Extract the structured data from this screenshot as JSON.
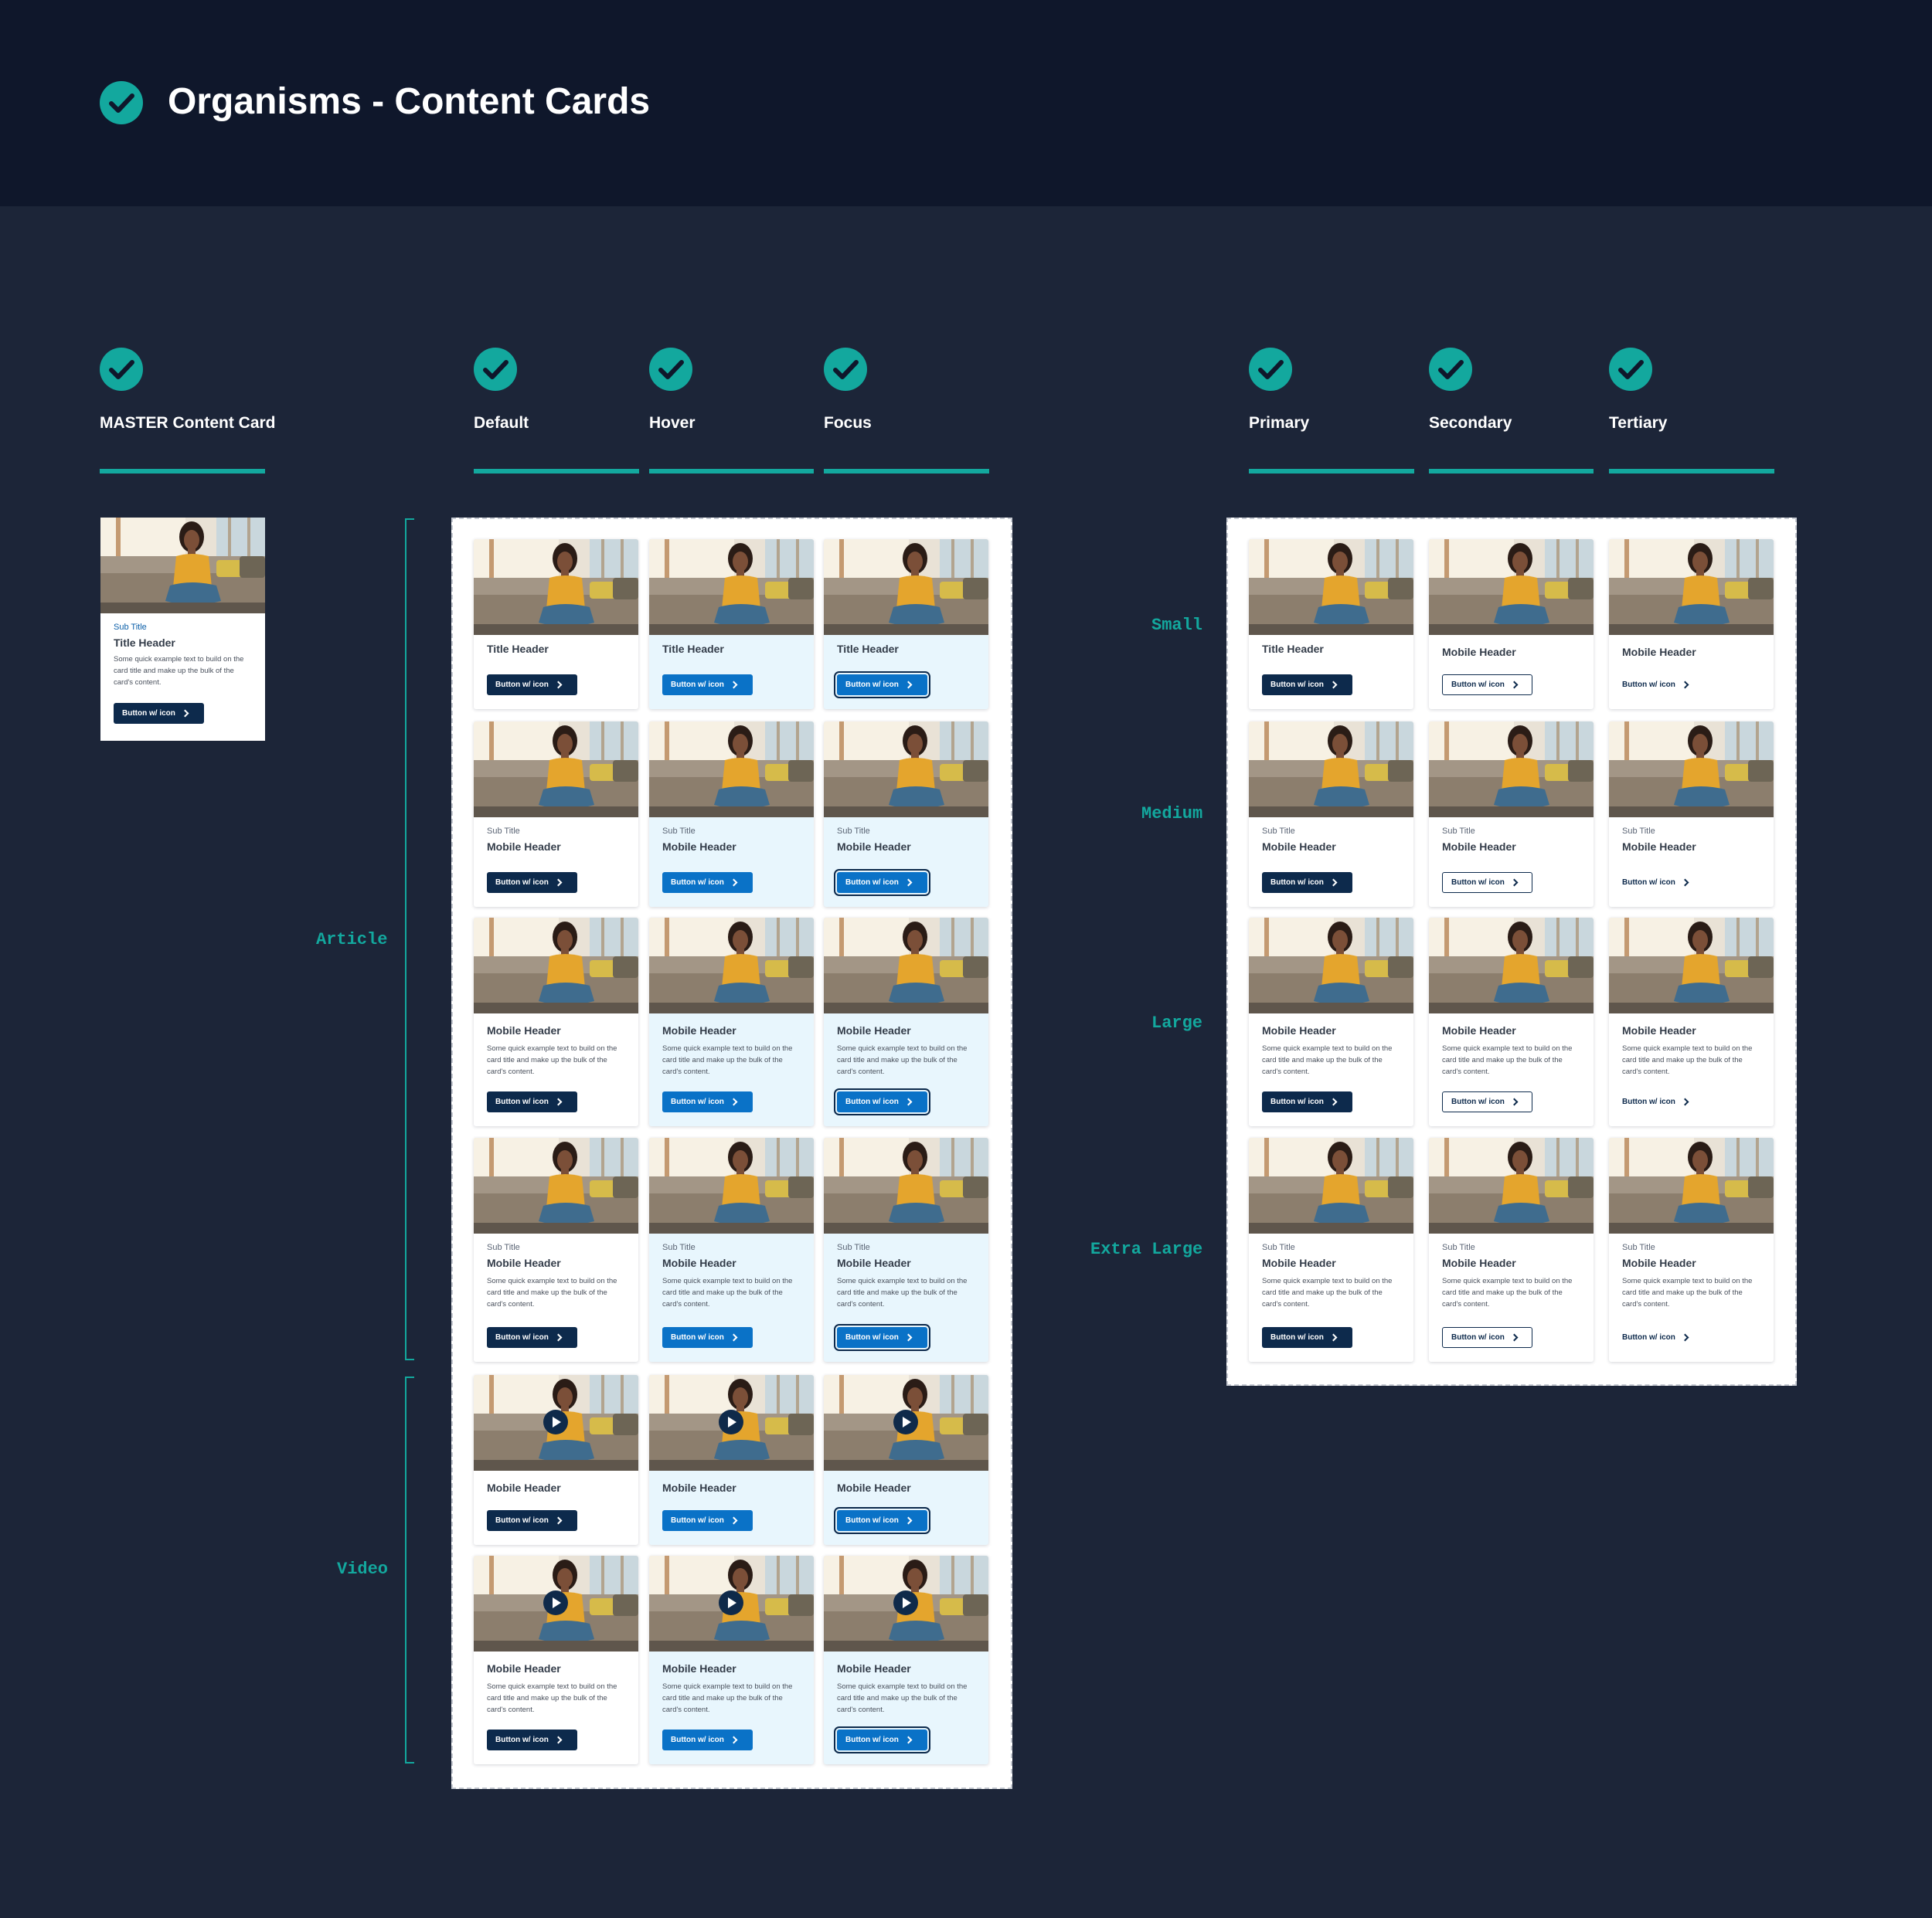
{
  "page": {
    "title": "Organisms - Content Cards"
  },
  "columns": {
    "master": "MASTER Content Card",
    "default": "Default",
    "hover": "Hover",
    "focus": "Focus",
    "primary": "Primary",
    "secondary": "Secondary",
    "tertiary": "Tertiary"
  },
  "rows": {
    "article": "Article",
    "video": "Video",
    "small": "Small",
    "medium": "Medium",
    "large": "Large",
    "xlarge": "Extra Large"
  },
  "card": {
    "sub_title": "Sub Title",
    "title_header": "Title Header",
    "mobile_header": "Mobile Header",
    "body": "Some quick example text to build on the card title and make up the bulk of the card's content.",
    "button": "Button w/ icon"
  },
  "colors": {
    "accent": "#13a89e",
    "header_bg": "#0f172b",
    "page_bg": "#1c2538",
    "button_default": "#0d2a4c",
    "button_hover": "#0a72c7",
    "card_hover_bg": "#e8f6fd"
  }
}
